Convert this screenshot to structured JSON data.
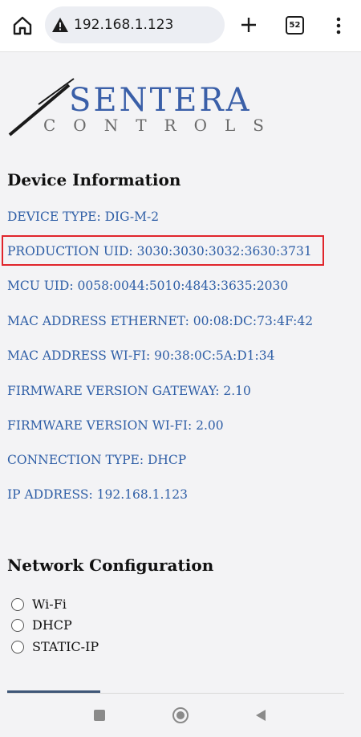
{
  "browser": {
    "url": "192.168.1.123",
    "tab_count": "52"
  },
  "logo": {
    "brand": "SENTERA",
    "subtitle": "CONTROLS"
  },
  "device_info": {
    "title": "Device Information",
    "items": [
      "DEVICE TYPE: DIG-M-2",
      "PRODUCTION UID: 3030:3030:3032:3630:3731",
      "MCU UID: 0058:0044:5010:4843:3635:2030",
      "MAC ADDRESS ETHERNET: 00:08:DC:73:4F:42",
      "MAC ADDRESS WI-FI: 90:38:0C:5A:D1:34",
      "FIRMWARE VERSION GATEWAY: 2.10",
      "FIRMWARE VERSION WI-FI: 2.00",
      "CONNECTION TYPE: DHCP",
      "IP ADDRESS: 192.168.1.123"
    ]
  },
  "network_config": {
    "title": "Network Configuration",
    "options": [
      "Wi-Fi",
      "DHCP",
      "STATIC-IP"
    ]
  },
  "colors": {
    "link_blue": "#2e5ea6",
    "highlight_red": "#e0242b",
    "logo_blue": "#3a5fa8"
  }
}
